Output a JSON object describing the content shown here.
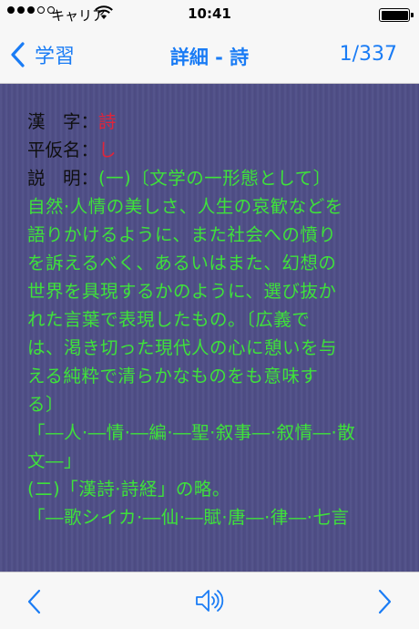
{
  "status_bar": {
    "carrier": "キャリア",
    "time": "10:41"
  },
  "nav": {
    "back_label": "学習",
    "title": "詳細 - 詩",
    "counter": "1/337"
  },
  "entry": {
    "kanji_label": "漢　字",
    "kanji_value": "詩",
    "kana_label": "平仮名",
    "kana_value": "し",
    "desc_label": "説　明",
    "separator": "：",
    "desc_first": "(一)〔文学の一形態として〕",
    "desc_lines": [
      "自然·人情の美しさ、人生の哀歓などを",
      "語りかけるように、また社会への憤り",
      "を訴えるべく、あるいはまた、幻想の",
      "世界を具現するかのように、選び抜か",
      "れた言葉で表現したもの。〔広義で",
      "は、渇き切った現代人の心に憩いを与",
      "える純粋で清らかなものをも意味す",
      "る〕",
      "「―人·―情·―編·―聖·叙事―·叙情―·散",
      "文―」",
      "(二)「漢詩·詩経」の略。",
      "「―歌シイカ·―仙·―賦·唐―·律―·七言"
    ]
  },
  "colors": {
    "accent": "#1a7cf5",
    "background": "#4f4e87",
    "meaning_text": "#3ee23a",
    "value_text": "#e0243a"
  },
  "toolbar": {
    "prev_icon": "chevron-left-icon",
    "speaker_icon": "speaker-icon",
    "next_icon": "chevron-right-icon"
  }
}
